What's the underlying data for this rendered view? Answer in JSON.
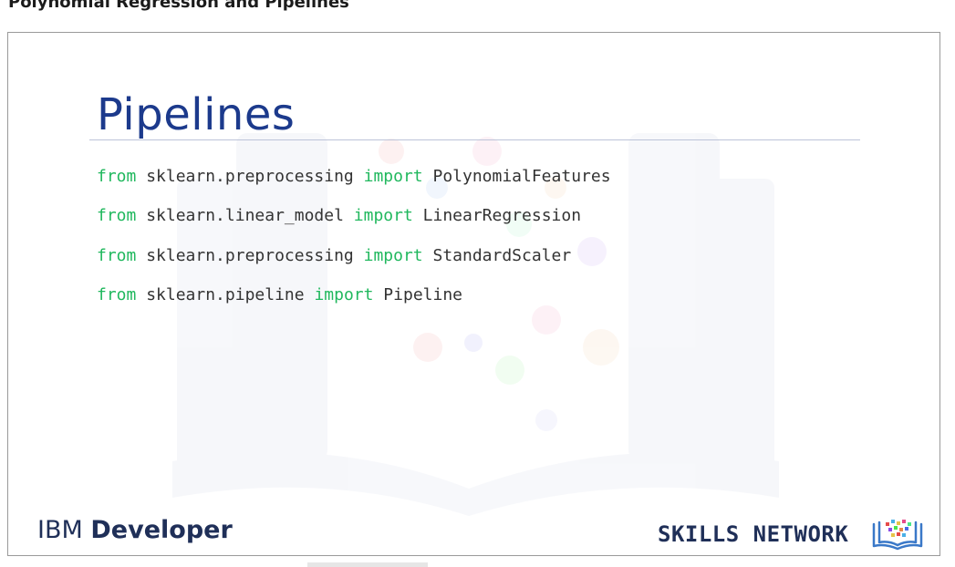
{
  "header": {
    "title": "Polynomial Regression and Pipelines"
  },
  "slide": {
    "title": "Pipelines",
    "code_lines": [
      {
        "kw1": "from",
        "module": " sklearn.preprocessing ",
        "kw2": "import",
        "name": " PolynomialFeatures"
      },
      {
        "kw1": "from",
        "module": " sklearn.linear_model ",
        "kw2": "import",
        "name": " LinearRegression"
      },
      {
        "kw1": "from",
        "module": " sklearn.preprocessing ",
        "kw2": "import",
        "name": " StandardScaler"
      },
      {
        "kw1": "from",
        "module": " sklearn.pipeline ",
        "kw2": "import",
        "name": " Pipeline"
      }
    ]
  },
  "footer": {
    "ibm_prefix": "IBM",
    "ibm_suffix": "Developer",
    "skills_network": "SKILLS NETWORK"
  },
  "colors": {
    "title": "#1c3a8c",
    "keyword": "#21b85e",
    "code_text": "#333333",
    "logo_text": "#1f2f58",
    "icon_book": "#3a78c8"
  },
  "icons": {
    "book": "book-icon",
    "watermark": "book-watermark"
  }
}
